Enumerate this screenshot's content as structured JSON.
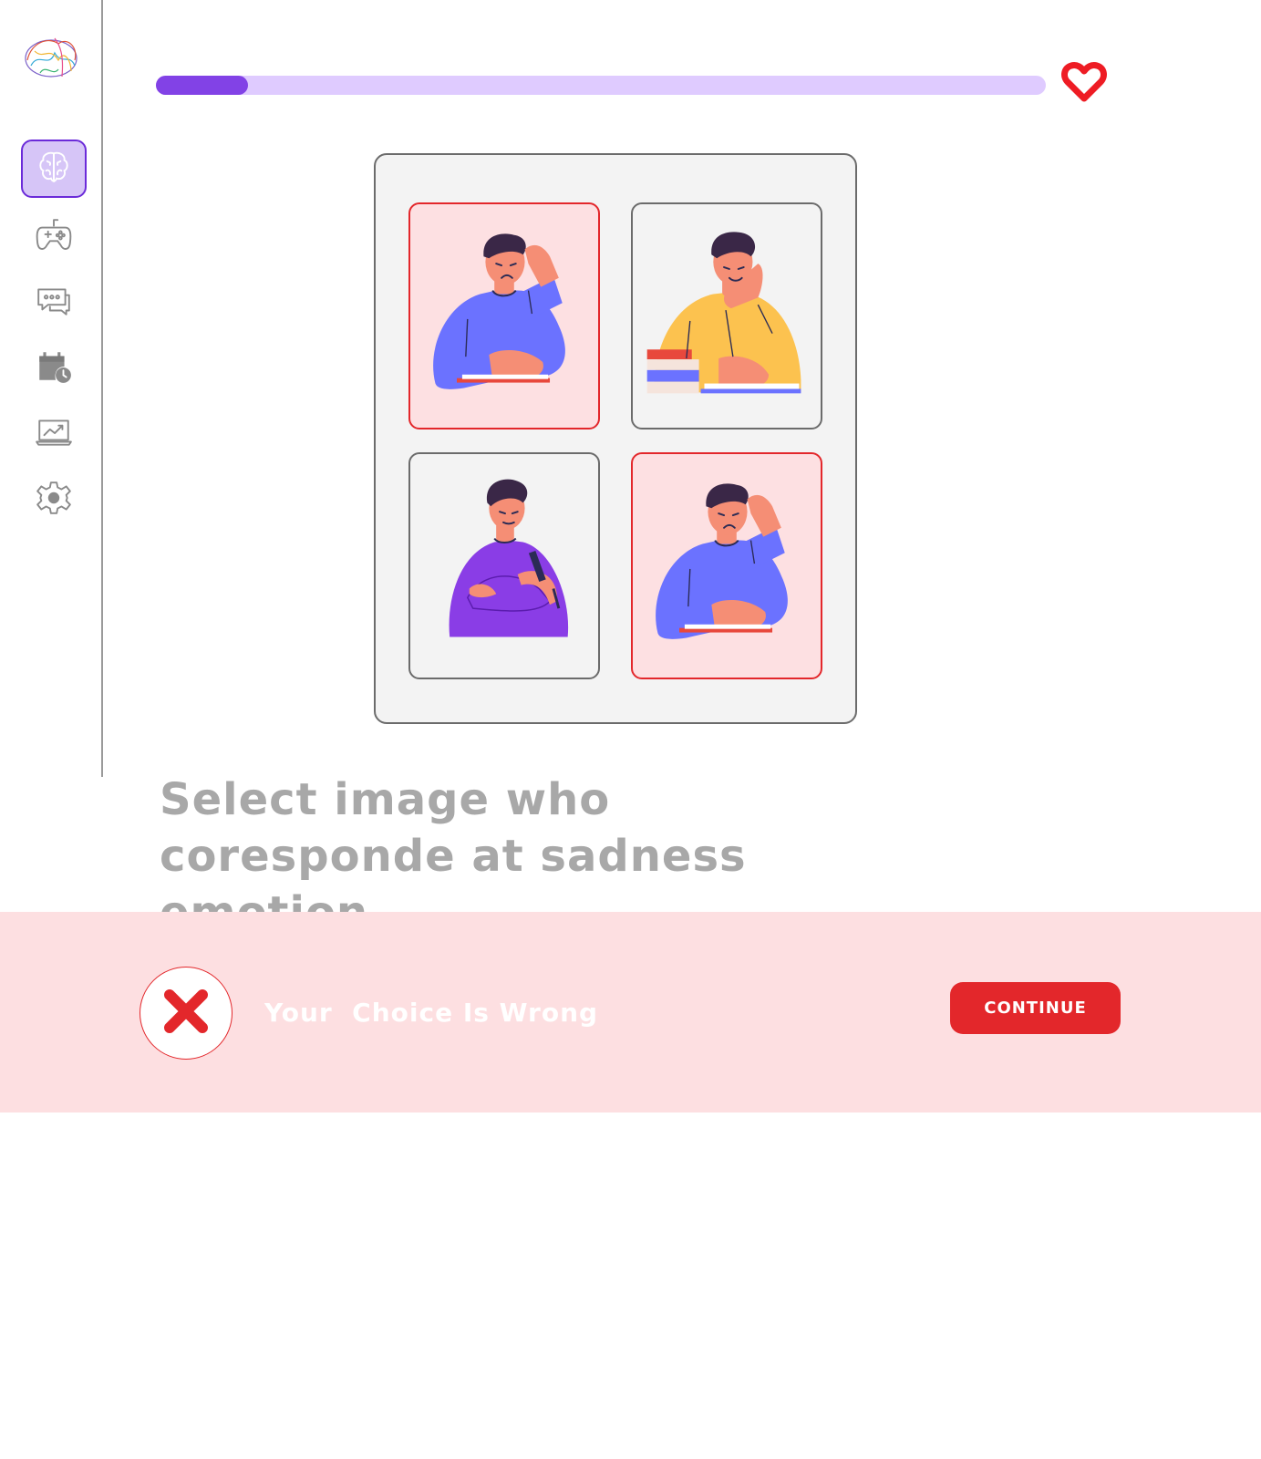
{
  "sidebar": {
    "logo": "brain-logo",
    "items": [
      {
        "id": "brain",
        "icon": "brain-icon",
        "active": true
      },
      {
        "id": "games",
        "icon": "gamepad-icon",
        "active": false
      },
      {
        "id": "chat",
        "icon": "chat-icon",
        "active": false
      },
      {
        "id": "schedule",
        "icon": "calendar-clock-icon",
        "active": false
      },
      {
        "id": "progress",
        "icon": "laptop-chart-icon",
        "active": false
      },
      {
        "id": "settings",
        "icon": "gear-icon",
        "active": false
      }
    ]
  },
  "progress": {
    "value": 0.103,
    "track_color": "#dfcbff",
    "fill_color": "#8242e6"
  },
  "lives": {
    "icon": "heart-icon",
    "color": "#ee1c24"
  },
  "quiz": {
    "question": "Select image who coresponde at sadness emotion.",
    "options": [
      {
        "id": "sad-blue-1",
        "state": "wrong",
        "shirt": "#6b72ff"
      },
      {
        "id": "thinking-yellow",
        "state": "normal",
        "shirt": "#fcc24f"
      },
      {
        "id": "writing-purple",
        "state": "normal",
        "shirt": "#8a3de6"
      },
      {
        "id": "sad-blue-2",
        "state": "wrong",
        "shirt": "#6b72ff"
      }
    ]
  },
  "feedback": {
    "icon": "x-icon",
    "message": "Your  Choice Is Wrong",
    "button_label": "CONTINUE",
    "bg_color": "#fddfe1",
    "accent_color": "#e3272b"
  }
}
